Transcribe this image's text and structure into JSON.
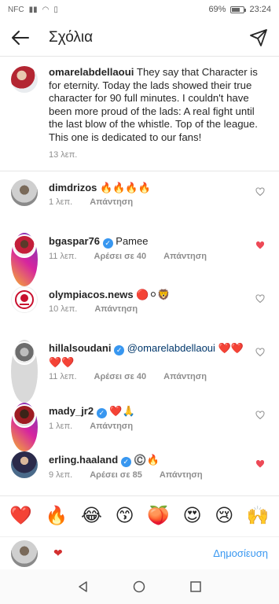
{
  "status_bar": {
    "carrier": "NFC",
    "battery_percent": "69%",
    "battery_level": 0.69,
    "time": "23:24"
  },
  "header": {
    "title": "Σχόλια"
  },
  "caption": {
    "username": "omarelabdellaoui",
    "text": " They say that Character is for eternity. Today the lads showed their true character for 90 full minutes. I couldn't have been more proud of the lads: A real fight until the last blow of the whistle. Top of the league. This one is dedicated to our fans!",
    "time": "13 λεπ."
  },
  "comments": [
    {
      "username": "dimdrizos",
      "verified": false,
      "text": " 🔥🔥🔥🔥",
      "mention": "",
      "time": "1 λεπ.",
      "likes": "",
      "reply": "Απάντηση",
      "liked": false
    },
    {
      "username": "bgaspar76",
      "verified": true,
      "text": " Pamee",
      "mention": "",
      "time": "11 λεπ.",
      "likes": "Αρέσει σε 40",
      "reply": "Απάντηση",
      "liked": true
    },
    {
      "username": "olympiacos.news",
      "verified": false,
      "text": " 🔴⚪🦁",
      "mention": "",
      "time": "10 λεπ.",
      "likes": "",
      "reply": "Απάντηση",
      "liked": false
    },
    {
      "username": "hillalsoudani",
      "verified": true,
      "text": " ❤️❤️❤️❤️",
      "mention": "@omarelabdellaoui",
      "time": "11 λεπ.",
      "likes": "Αρέσει σε 40",
      "reply": "Απάντηση",
      "liked": false
    },
    {
      "username": "mady_jr2",
      "verified": true,
      "text": " ❤️🙏",
      "mention": "",
      "time": "1 λεπ.",
      "likes": "",
      "reply": "Απάντηση",
      "liked": false
    },
    {
      "username": "erling.haaland",
      "verified": true,
      "text": " ©️🔥",
      "mention": "",
      "time": "9 λεπ.",
      "likes": "Αρέσει σε 85",
      "reply": "Απάντηση",
      "liked": true
    }
  ],
  "emoji_bar": [
    "❤️",
    "🔥",
    "😂",
    "😙",
    "🍑",
    "😍",
    "😢",
    "🙌"
  ],
  "input": {
    "value": "❤",
    "post_label": "Δημοσίευση"
  },
  "colors": {
    "accent_blue": "#3897f0",
    "heart_red": "#ed4956",
    "muted": "#8e8e8e"
  }
}
